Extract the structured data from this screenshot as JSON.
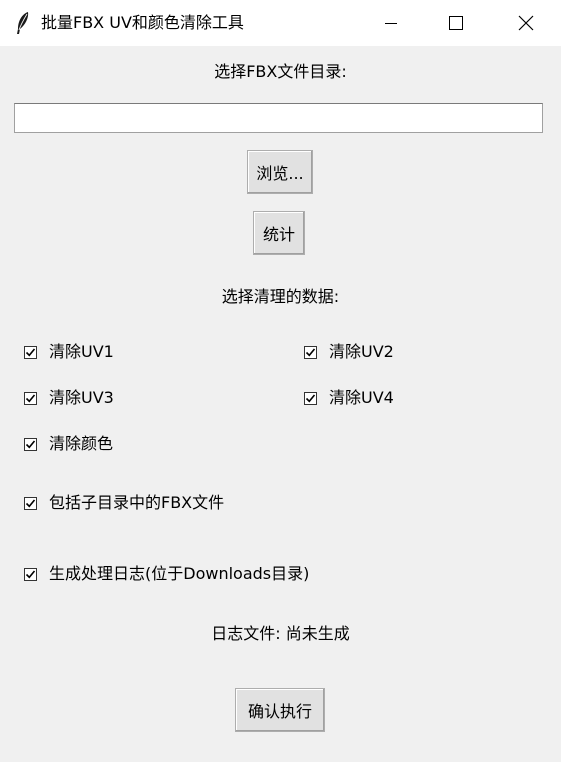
{
  "window": {
    "title": "批量FBX UV和颜色清除工具",
    "icon": "feather-icon"
  },
  "directory": {
    "label": "选择FBX文件目录:",
    "path_value": "",
    "browse_button": "浏览...",
    "stats_button": "统计"
  },
  "clean": {
    "label": "选择清理的数据:",
    "options": [
      {
        "label": "清除UV1",
        "checked": true
      },
      {
        "label": "清除UV2",
        "checked": true
      },
      {
        "label": "清除UV3",
        "checked": true
      },
      {
        "label": "清除UV4",
        "checked": true
      },
      {
        "label": "清除颜色",
        "checked": true
      }
    ]
  },
  "include_subdirs": {
    "label": "包括子目录中的FBX文件",
    "checked": true
  },
  "generate_log": {
    "label": "生成处理日志(位于Downloads目录)",
    "checked": true
  },
  "log_file_text": "日志文件: 尚未生成",
  "run_button": "确认执行"
}
